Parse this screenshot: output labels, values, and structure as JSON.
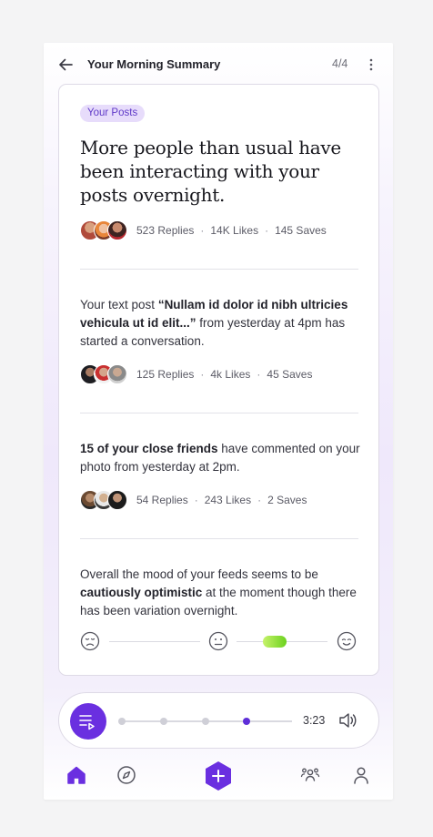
{
  "header": {
    "title": "Your Morning Summary",
    "page_count": "4/4",
    "back_icon": "arrow-left-icon",
    "more_icon": "more-vertical-icon"
  },
  "card": {
    "tag": "Your Posts",
    "headline": "More people than usual have been interacting with your posts overnight.",
    "summary_stats": {
      "replies": "523 Replies",
      "likes": "14K Likes",
      "saves": "145 Saves"
    },
    "text_post": {
      "prefix": "Your text post ",
      "quote": "“Nullam id dolor id nibh ultricies vehicula ut id elit...”",
      "suffix": " from yesterday at 4pm has started a conversation.",
      "stats": {
        "replies": "125 Replies",
        "likes": "4k Likes",
        "saves": "45 Saves"
      }
    },
    "friends_post": {
      "bold": "15 of your close friends",
      "suffix": " have commented on your photo from yesterday at 2pm.",
      "stats": {
        "replies": "54 Replies",
        "likes": "243 Likes",
        "saves": "2 Saves"
      }
    },
    "mood": {
      "prefix": "Overall the mood of your feeds seems to be ",
      "bold": "cautiously optimistic",
      "suffix": " at the moment though there has been variation overnight.",
      "level": 0.72,
      "left_icon": "sad-face-icon",
      "mid_icon": "neutral-face-icon",
      "right_icon": "happy-face-icon"
    }
  },
  "player": {
    "time": "3:23",
    "progress_step": 4,
    "steps": 4,
    "play_icon": "playlist-play-icon",
    "volume_icon": "volume-icon"
  },
  "nav": {
    "items": [
      "home-icon",
      "explore-icon",
      "add-icon",
      "people-icon",
      "profile-icon"
    ],
    "active": "home-icon"
  },
  "colors": {
    "accent": "#6a2fe0",
    "tag_bg": "#e7dcfb",
    "mood_green": "#6cd21f"
  }
}
